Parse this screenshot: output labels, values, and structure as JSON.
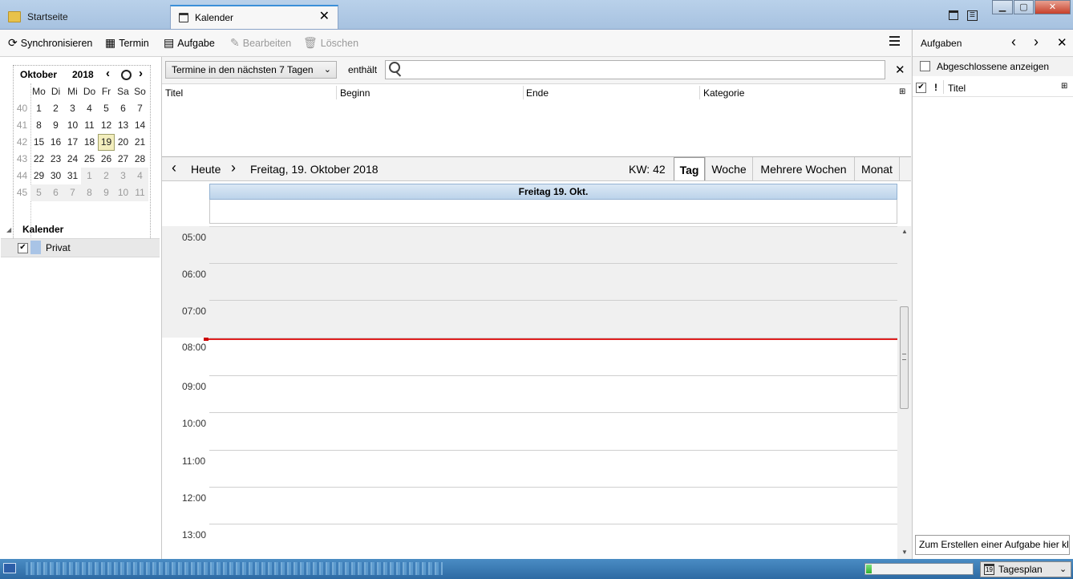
{
  "tabs": [
    {
      "label": "Startseite",
      "icon": "folder-icon",
      "active": false
    },
    {
      "label": "Kalender",
      "icon": "calendar-icon",
      "active": true
    }
  ],
  "toolbar": {
    "sync_label": "Synchronisieren",
    "event_label": "Termin",
    "task_label": "Aufgabe",
    "edit_label": "Bearbeiten",
    "delete_label": "Löschen"
  },
  "minical": {
    "month": "Oktober",
    "year": "2018",
    "weekdays": [
      "Mo",
      "Di",
      "Mi",
      "Do",
      "Fr",
      "Sa",
      "So"
    ],
    "weeks": [
      {
        "num": "40",
        "days": [
          "1",
          "2",
          "3",
          "4",
          "5",
          "6",
          "7"
        ]
      },
      {
        "num": "41",
        "days": [
          "8",
          "9",
          "10",
          "11",
          "12",
          "13",
          "14"
        ]
      },
      {
        "num": "42",
        "days": [
          "15",
          "16",
          "17",
          "18",
          "19",
          "20",
          "21"
        ]
      },
      {
        "num": "43",
        "days": [
          "22",
          "23",
          "24",
          "25",
          "26",
          "27",
          "28"
        ]
      },
      {
        "num": "44",
        "days": [
          "29",
          "30",
          "31",
          "1",
          "2",
          "3",
          "4"
        ]
      },
      {
        "num": "45",
        "days": [
          "5",
          "6",
          "7",
          "8",
          "9",
          "10",
          "11"
        ]
      }
    ],
    "today": "19"
  },
  "calendars": {
    "title": "Kalender",
    "items": [
      {
        "name": "Privat",
        "checked": true,
        "color": "#a9c4e6"
      }
    ]
  },
  "filter": {
    "selected": "Termine in den nächsten 7 Tagen",
    "contains_label": "enthält",
    "search_value": ""
  },
  "columns": [
    "Titel",
    "Beginn",
    "Ende",
    "Kategorie"
  ],
  "nav": {
    "today_label": "Heute",
    "date_label": "Freitag, 19. Oktober 2018",
    "week_label": "KW: 42",
    "views": [
      "Tag",
      "Woche",
      "Mehrere Wochen",
      "Monat"
    ]
  },
  "dayview": {
    "header": "Freitag 19. Okt.",
    "hours": [
      "05:00",
      "06:00",
      "07:00",
      "08:00",
      "09:00",
      "10:00",
      "11:00",
      "12:00",
      "13:00"
    ]
  },
  "tasks": {
    "title": "Aufgaben",
    "show_completed_label": "Abgeschlossene anzeigen",
    "column_title": "Titel",
    "priority_glyph": "!",
    "new_task_placeholder": "Zum Erstellen einer Aufgabe hier kl"
  },
  "statusbar": {
    "today_pane_label": "Tagesplan",
    "today_pane_day": "19",
    "progress": 0.05
  },
  "colors": {
    "accent": "#3a8fd8",
    "now_line": "#e02020",
    "day_header": "#bcd3ea",
    "offhours": "#f0f0f0"
  }
}
